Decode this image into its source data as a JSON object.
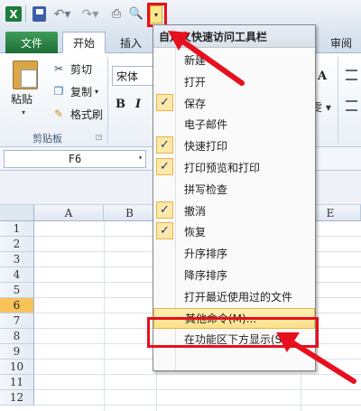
{
  "qat": {
    "app_icon": "X",
    "icons": [
      "excel-app-icon",
      "save-icon",
      "undo-icon",
      "redo-icon",
      "print-icon",
      "print-preview-icon",
      "customize-dropdown-icon"
    ],
    "undo_glyph": "↶▾",
    "redo_glyph": "↷▾",
    "print_glyph": "⎙",
    "preview_glyph": "🔍",
    "customize_glyph": "▾"
  },
  "tabs": {
    "file": "文件",
    "home": "开始",
    "insert": "插入",
    "review": "审阅"
  },
  "ribbon": {
    "paste": "粘贴",
    "cut": "剪切",
    "copy": "复制",
    "copy_arrow": "▾",
    "format_painter": "格式刷",
    "clipboard_group": "剪贴板",
    "font_name": "宋体",
    "bold": "B",
    "italic": "I",
    "font_size_up": "A",
    "wen": "雯 ▾"
  },
  "formula_bar": {
    "name_box": "F6",
    "arrow": "▾"
  },
  "grid": {
    "columns": [
      "A",
      "B",
      "E"
    ],
    "rows": [
      "1",
      "2",
      "3",
      "4",
      "5",
      "6",
      "7",
      "8",
      "9",
      "10",
      "11",
      "12"
    ],
    "active_row": "6"
  },
  "menu": {
    "header": "自定义快速访问工具栏",
    "items": [
      {
        "label": "新建",
        "checked": false
      },
      {
        "label": "打开",
        "checked": false
      },
      {
        "label": "保存",
        "checked": true
      },
      {
        "label": "电子邮件",
        "checked": false
      },
      {
        "label": "快速打印",
        "checked": true
      },
      {
        "label": "打印预览和打印",
        "checked": true
      },
      {
        "label": "拼写检查",
        "checked": false
      },
      {
        "label": "撤消",
        "checked": true
      },
      {
        "label": "恢复",
        "checked": true
      },
      {
        "label": "升序排序",
        "checked": false
      },
      {
        "label": "降序排序",
        "checked": false
      },
      {
        "label": "打开最近使用过的文件",
        "checked": false
      },
      {
        "label": "其他命令(M)...",
        "checked": false,
        "highlighted": true
      },
      {
        "label": "在功能区下方显示(S)",
        "checked": false
      }
    ],
    "check_glyph": "✓"
  },
  "colors": {
    "annotation_red": "#e6101e",
    "file_tab_green": "#1d6e38",
    "highlight_yellow": "#fbe08a"
  }
}
